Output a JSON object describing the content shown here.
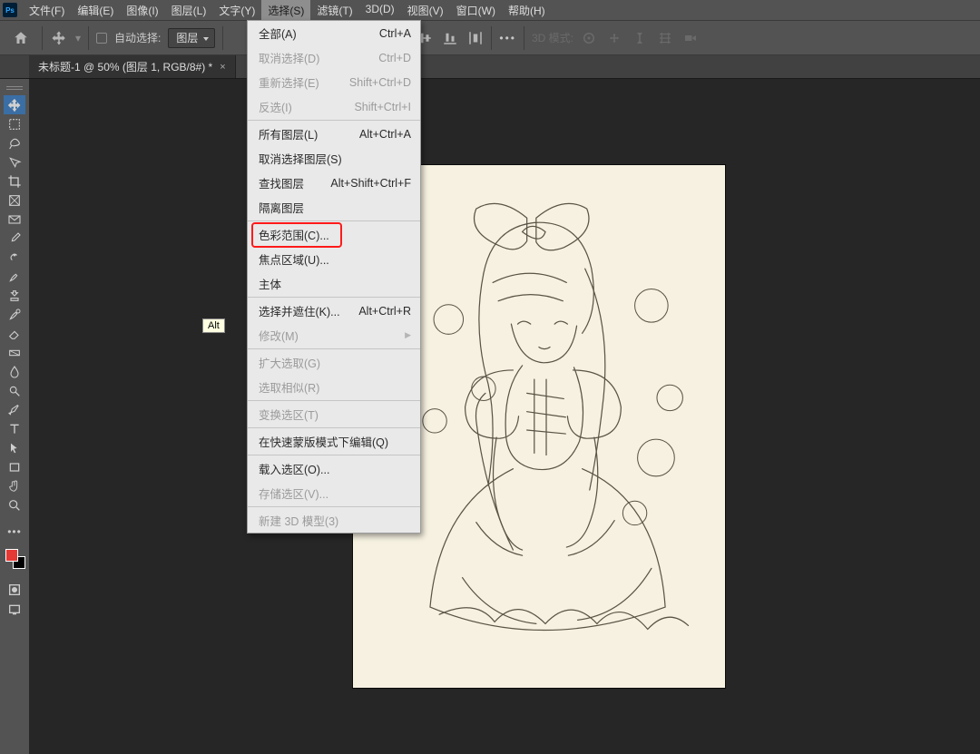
{
  "menubar": {
    "items": [
      "文件(F)",
      "编辑(E)",
      "图像(I)",
      "图层(L)",
      "文字(Y)",
      "选择(S)",
      "滤镜(T)",
      "3D(D)",
      "视图(V)",
      "窗口(W)",
      "帮助(H)"
    ],
    "activeIndex": 5
  },
  "optbar": {
    "auto_select_label": "自动选择:",
    "target_dd": "图层",
    "threeD_label": "3D 模式:"
  },
  "doctab": {
    "title": "未标题-1 @ 50% (图层 1, RGB/8#) *"
  },
  "altTip": "Alt",
  "selectMenu": {
    "groups": [
      [
        {
          "label": "全部(A)",
          "shortcut": "Ctrl+A",
          "disabled": false
        },
        {
          "label": "取消选择(D)",
          "shortcut": "Ctrl+D",
          "disabled": true
        },
        {
          "label": "重新选择(E)",
          "shortcut": "Shift+Ctrl+D",
          "disabled": true
        },
        {
          "label": "反选(I)",
          "shortcut": "Shift+Ctrl+I",
          "disabled": true
        }
      ],
      [
        {
          "label": "所有图层(L)",
          "shortcut": "Alt+Ctrl+A",
          "disabled": false
        },
        {
          "label": "取消选择图层(S)",
          "shortcut": "",
          "disabled": false
        },
        {
          "label": "查找图层",
          "shortcut": "Alt+Shift+Ctrl+F",
          "disabled": false
        },
        {
          "label": "隔离图层",
          "shortcut": "",
          "disabled": false
        }
      ],
      [
        {
          "label": "色彩范围(C)...",
          "shortcut": "",
          "disabled": false,
          "highlight": true
        },
        {
          "label": "焦点区域(U)...",
          "shortcut": "",
          "disabled": false
        },
        {
          "label": "主体",
          "shortcut": "",
          "disabled": false
        }
      ],
      [
        {
          "label": "选择并遮住(K)...",
          "shortcut": "Alt+Ctrl+R",
          "disabled": false
        },
        {
          "label": "修改(M)",
          "shortcut": "",
          "disabled": true,
          "arrow": true
        }
      ],
      [
        {
          "label": "扩大选取(G)",
          "shortcut": "",
          "disabled": true
        },
        {
          "label": "选取相似(R)",
          "shortcut": "",
          "disabled": true
        }
      ],
      [
        {
          "label": "变换选区(T)",
          "shortcut": "",
          "disabled": true
        }
      ],
      [
        {
          "label": "在快速蒙版模式下编辑(Q)",
          "shortcut": "",
          "disabled": false
        }
      ],
      [
        {
          "label": "载入选区(O)...",
          "shortcut": "",
          "disabled": false
        },
        {
          "label": "存储选区(V)...",
          "shortcut": "",
          "disabled": true
        }
      ],
      [
        {
          "label": "新建 3D 模型(3)",
          "shortcut": "",
          "disabled": true
        }
      ]
    ]
  },
  "tools": [
    "move",
    "marquee",
    "lasso",
    "quick-select",
    "crop",
    "frame",
    "envelope",
    "eyedropper",
    "spot-heal",
    "brush",
    "clone",
    "history-brush",
    "eraser",
    "gradient",
    "blur",
    "dodge",
    "pen",
    "type",
    "path-select",
    "rectangle",
    "hand",
    "zoom"
  ]
}
